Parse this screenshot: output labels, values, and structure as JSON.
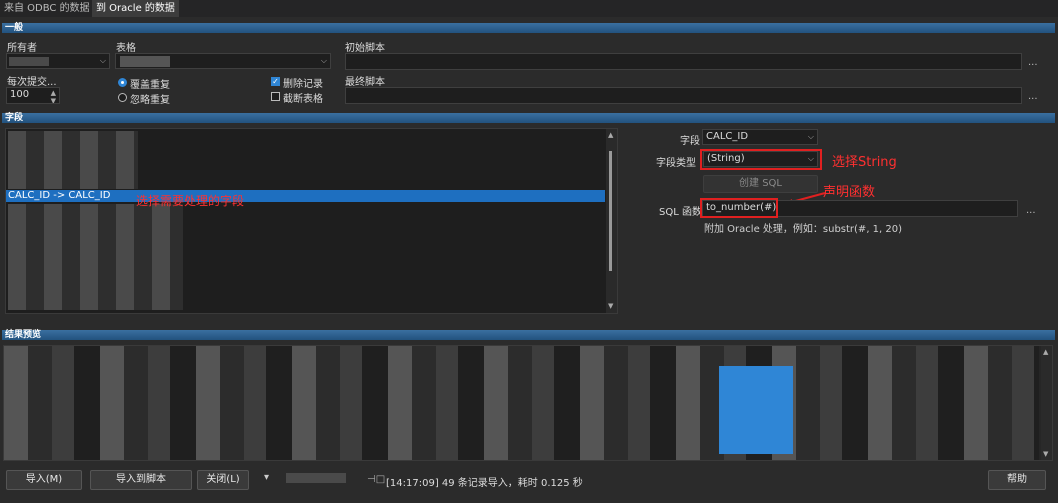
{
  "tabs": [
    "来自 ODBC 的数据",
    "到 Oracle 的数据"
  ],
  "general": {
    "section_title": "一般",
    "owner_label": "所有者",
    "table_label": "表格",
    "init_script_label": "初始脚本",
    "final_script_label": "最终脚本",
    "commit_label": "每次提交...",
    "commit_value": "100",
    "radio_overwrite": "覆盖重复",
    "radio_ignore": "忽略重复",
    "check_delete": "删除记录",
    "check_truncate": "截断表格",
    "dots": "..."
  },
  "fields": {
    "section_title": "字段",
    "mapping_row": "CALC_ID  ->  CALC_ID",
    "field_label": "字段",
    "field_value": "CALC_ID",
    "type_label": "字段类型",
    "type_value": "(String)",
    "create_sql_label": "创建 SQL",
    "sql_func_label": "SQL 函数",
    "sql_func_value": "to_number(#)",
    "hint": "附加 Oracle 处理，例如：substr(#, 1, 20)",
    "dots": "..."
  },
  "annotations": {
    "select_string": "选择String",
    "declare_function": "声明函数",
    "select_field": "选择需要处理的字段"
  },
  "preview": {
    "section_title": "结果预览"
  },
  "footer": {
    "import_button": "导入(M)",
    "import_to_script_button": "导入到脚本",
    "close_button": "关闭(L)",
    "status": "[14:17:09]  49 条记录导入，耗时 0.125 秒",
    "help_button": "帮助"
  },
  "colors": {
    "accent": "#2f86d6",
    "section_bar": "#2c5f8f",
    "annotation_red": "#e02020",
    "selection": "#1e6fc0"
  }
}
